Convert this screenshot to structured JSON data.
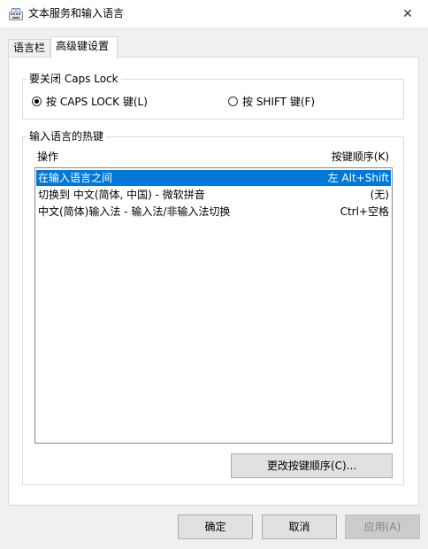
{
  "window": {
    "title": "文本服务和输入语言",
    "close_symbol": "✕"
  },
  "tabs": [
    {
      "label": "语言栏"
    },
    {
      "label": "高级键设置"
    }
  ],
  "caps_lock": {
    "legend": "要关闭 Caps Lock",
    "options": [
      {
        "label": "按 CAPS LOCK 键(L)",
        "checked": true
      },
      {
        "label": "按 SHIFT 键(F)",
        "checked": false
      }
    ]
  },
  "hotkeys": {
    "legend": "输入语言的热键",
    "col_action": "操作",
    "col_sequence": "按键顺序(K)",
    "rows": [
      {
        "action": "在输入语言之间",
        "sequence": "左 Alt+Shift",
        "selected": true
      },
      {
        "action": "切换到 中文(简体, 中国) - 微软拼音",
        "sequence": "(无)",
        "selected": false
      },
      {
        "action": "中文(简体)输入法 - 输入法/非输入法切换",
        "sequence": "Ctrl+空格",
        "selected": false
      }
    ],
    "change_button": "更改按键顺序(C)..."
  },
  "footer": {
    "ok": "确定",
    "cancel": "取消",
    "apply": "应用(A)"
  },
  "colors": {
    "selection": "#0078d7",
    "background": "#f0f0f0"
  }
}
